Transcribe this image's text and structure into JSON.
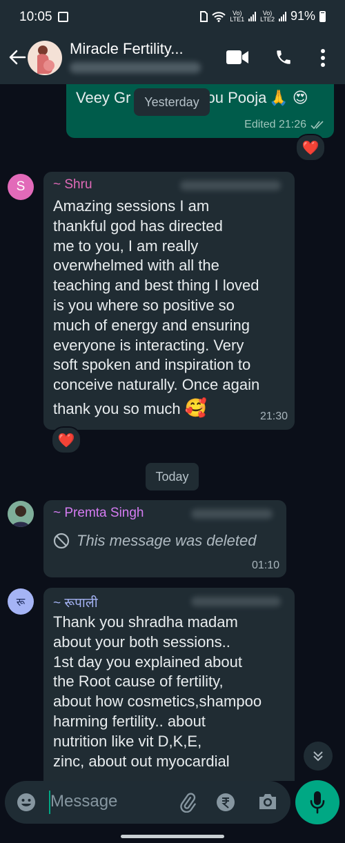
{
  "status": {
    "time": "10:05",
    "battery": "91%",
    "net1": "Vo)\nLTE1",
    "net2": "Vo)\nLTE2"
  },
  "header": {
    "title": "Miracle Fertility..."
  },
  "messages": {
    "top": {
      "text": "Veey Gr",
      "text2": "ou Pooja",
      "meta": "Edited 21:26"
    },
    "yesterday": "Yesterday",
    "shru": {
      "sender": "~ Shru",
      "lines": [
        "Amazing sessions I am",
        "thankful god has directed",
        "me to you, I am really",
        "overwhelmed with all the",
        "teaching and best thing I loved",
        "is you where so positive so",
        "much of energy and ensuring",
        "everyone is interacting. Very",
        "soft spoken and inspiration to",
        "conceive naturally. Once again"
      ],
      "last": "thank you so much",
      "time": "21:30",
      "avatar": "S"
    },
    "today": "Today",
    "premta": {
      "sender": "~ Premta Singh",
      "deleted": "This message was deleted",
      "time": "01:10"
    },
    "rupali": {
      "sender": "~ रूपाली",
      "avatar": "रू",
      "lines": [
        "Thank you shradha madam",
        "about your both sessions..",
        "1st day you explained about",
        "the Root cause of fertility,",
        "about how cosmetics,shampoo",
        "harming fertility.. about",
        "nutrition like vit D,K,E,",
        "zinc, about out myocardial"
      ]
    }
  },
  "input": {
    "placeholder": "Message"
  },
  "colors": {
    "outgoing": "#005c4b",
    "incoming": "#202c33",
    "accent": "#00a884",
    "shru": "#e26ab9",
    "premta": "#d57cf2",
    "rupali": "#a5b4f5"
  }
}
